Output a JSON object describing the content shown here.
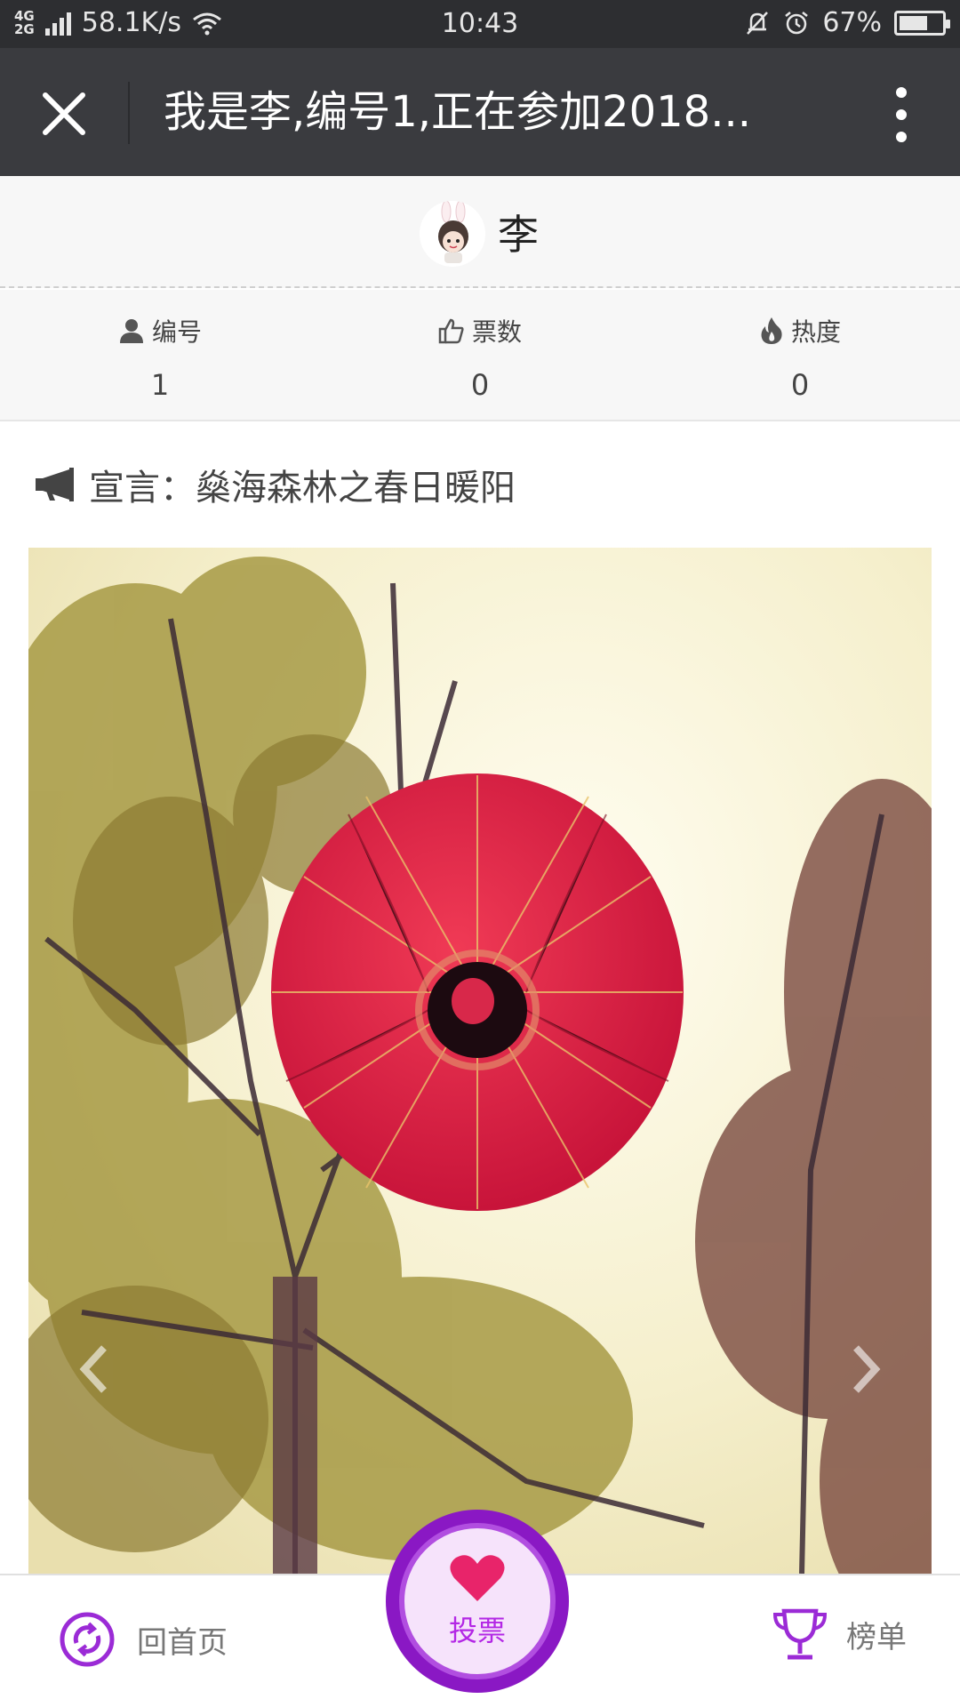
{
  "status_bar": {
    "network": "4G 2G",
    "speed": "58.1K/s",
    "time": "10:43",
    "battery_text": "67%",
    "battery_level": 0.67,
    "icons": [
      "signal-icon",
      "wifi-icon",
      "bell-muted-icon",
      "alarm-icon",
      "battery-icon"
    ]
  },
  "header": {
    "title": "我是李,编号1,正在参加2018..."
  },
  "profile": {
    "name": "李"
  },
  "stats": [
    {
      "label": "编号",
      "value": "1",
      "icon": "user-icon"
    },
    {
      "label": "票数",
      "value": "0",
      "icon": "thumbs-up-icon"
    },
    {
      "label": "热度",
      "value": "0",
      "icon": "flame-icon"
    }
  ],
  "declaration": {
    "text": "宣言：燊海森林之春日暖阳",
    "icon": "megaphone-icon"
  },
  "bottom_nav": {
    "home_label": "回首页",
    "vote_label": "投票",
    "rank_label": "榜单"
  },
  "colors": {
    "accent": "#8a18c4",
    "accent_light": "#b327e5",
    "heart": "#e8246a",
    "titlebar": "#3a3b3f",
    "statusbar": "#2d2e31"
  }
}
